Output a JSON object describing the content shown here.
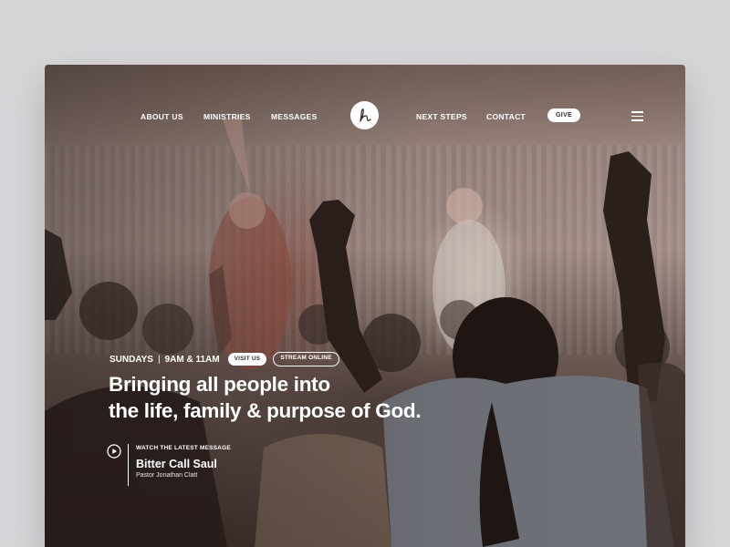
{
  "nav": {
    "left_links": [
      "ABOUT US",
      "MINISTRIES",
      "MESSAGES"
    ],
    "right_links": [
      "NEXT STEPS",
      "CONTACT"
    ],
    "give_label": "GIVE",
    "logo_letter": "h"
  },
  "hero": {
    "service_day": "SUNDAYS",
    "separator": "|",
    "service_times": "9AM & 11AM",
    "visit_label": "VISIT US",
    "stream_label": "STREAM ONLINE",
    "headline_line1": "Bringing all people into",
    "headline_line2": "the life, family & purpose of God."
  },
  "message": {
    "caption": "WATCH THE LATEST MESSAGE",
    "title": "Bitter Call Saul",
    "pastor": "Pastor Jonathan Clatt"
  },
  "colors": {
    "page_background": "#d6d5d8",
    "text": "#ffffff",
    "button_background": "#ffffff",
    "button_text": "#3a302d"
  }
}
